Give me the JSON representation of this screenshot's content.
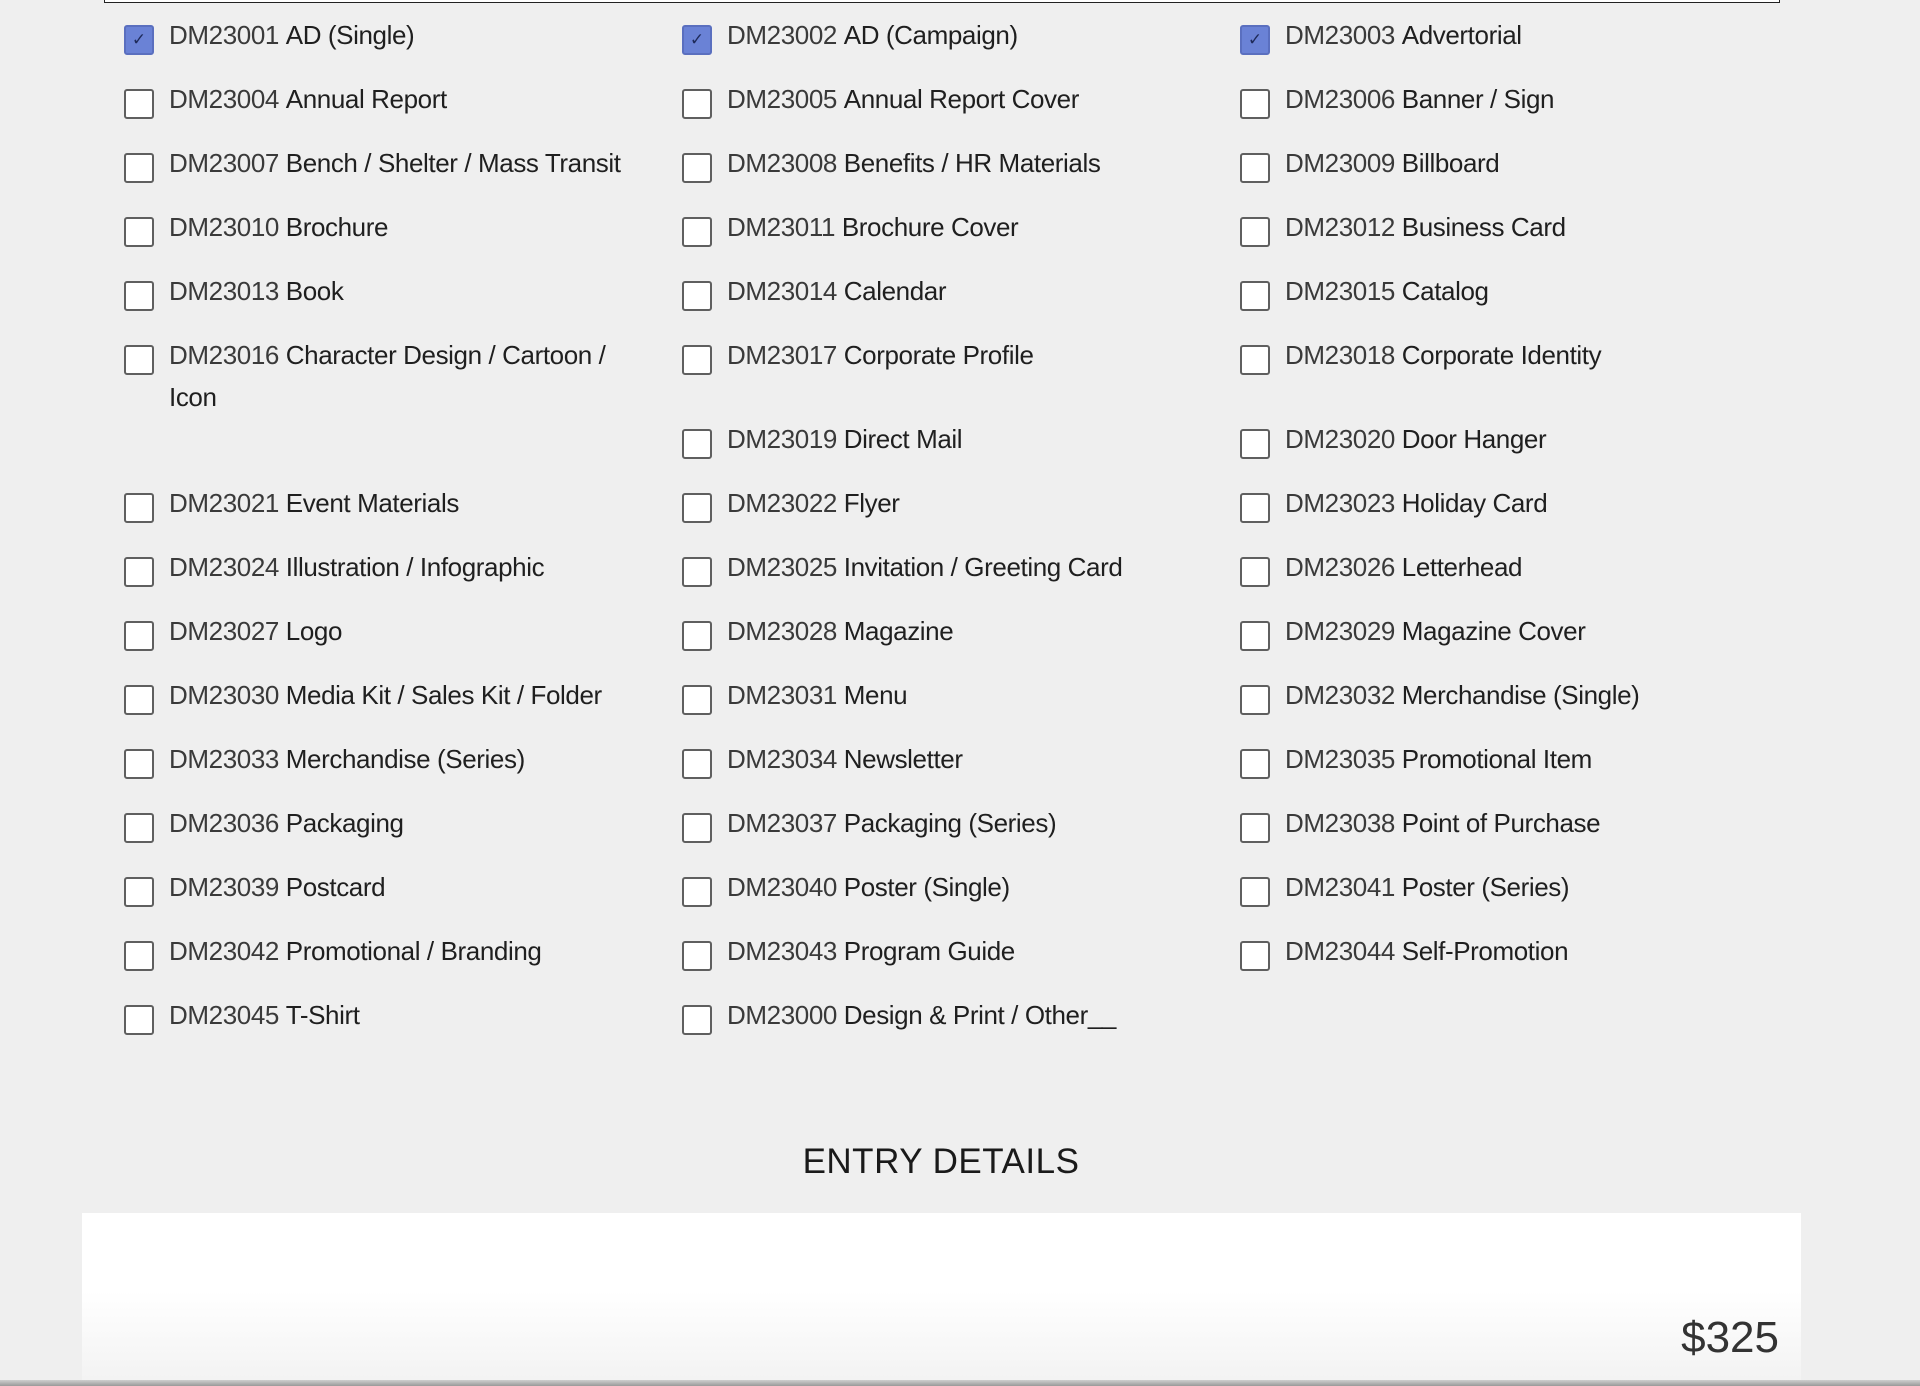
{
  "categories": [
    {
      "code": "DM23001",
      "name": "AD (Single)",
      "checked": true
    },
    {
      "code": "DM23002",
      "name": "AD (Campaign)",
      "checked": true
    },
    {
      "code": "DM23003",
      "name": "Advertorial",
      "checked": true
    },
    {
      "code": "DM23004",
      "name": "Annual Report",
      "checked": false
    },
    {
      "code": "DM23005",
      "name": "Annual Report Cover",
      "checked": false
    },
    {
      "code": "DM23006",
      "name": "Banner / Sign",
      "checked": false
    },
    {
      "code": "DM23007",
      "name": "Bench / Shelter / Mass Transit",
      "checked": false
    },
    {
      "code": "DM23008",
      "name": "Benefits / HR Materials",
      "checked": false
    },
    {
      "code": "DM23009",
      "name": "Billboard",
      "checked": false
    },
    {
      "code": "DM23010",
      "name": "Brochure",
      "checked": false
    },
    {
      "code": "DM23011",
      "name": "Brochure Cover",
      "checked": false
    },
    {
      "code": "DM23012",
      "name": "Business Card",
      "checked": false
    },
    {
      "code": "DM23013",
      "name": "Book",
      "checked": false
    },
    {
      "code": "DM23014",
      "name": "Calendar",
      "checked": false
    },
    {
      "code": "DM23015",
      "name": "Catalog",
      "checked": false
    },
    {
      "code": "DM23016",
      "name": "Character Design / Cartoon / Icon",
      "checked": false
    },
    {
      "code": "DM23017",
      "name": "Corporate Profile",
      "checked": false
    },
    {
      "code": "DM23018",
      "name": "Corporate Identity",
      "checked": false
    },
    {
      "code": "",
      "name": "",
      "checked": false,
      "placeholder": true
    },
    {
      "code": "DM23019",
      "name": "Direct Mail",
      "checked": false
    },
    {
      "code": "DM23020",
      "name": "Door Hanger",
      "checked": false
    },
    {
      "code": "DM23021",
      "name": "Event Materials",
      "checked": false
    },
    {
      "code": "DM23022",
      "name": "Flyer",
      "checked": false
    },
    {
      "code": "DM23023",
      "name": "Holiday Card",
      "checked": false
    },
    {
      "code": "DM23024",
      "name": "Illustration / Infographic",
      "checked": false
    },
    {
      "code": "DM23025",
      "name": "Invitation / Greeting Card",
      "checked": false
    },
    {
      "code": "DM23026",
      "name": "Letterhead",
      "checked": false
    },
    {
      "code": "DM23027",
      "name": "Logo",
      "checked": false
    },
    {
      "code": "DM23028",
      "name": "Magazine",
      "checked": false
    },
    {
      "code": "DM23029",
      "name": "Magazine Cover",
      "checked": false
    },
    {
      "code": "DM23030",
      "name": "Media Kit / Sales Kit / Folder",
      "checked": false
    },
    {
      "code": "DM23031",
      "name": "Menu",
      "checked": false
    },
    {
      "code": "DM23032",
      "name": "Merchandise (Single)",
      "checked": false
    },
    {
      "code": "DM23033",
      "name": "Merchandise (Series)",
      "checked": false
    },
    {
      "code": "DM23034",
      "name": "Newsletter",
      "checked": false
    },
    {
      "code": "DM23035",
      "name": "Promotional Item",
      "checked": false
    },
    {
      "code": "DM23036",
      "name": "Packaging",
      "checked": false
    },
    {
      "code": "DM23037",
      "name": "Packaging (Series)",
      "checked": false
    },
    {
      "code": "DM23038",
      "name": "Point of Purchase",
      "checked": false
    },
    {
      "code": "DM23039",
      "name": "Postcard",
      "checked": false
    },
    {
      "code": "DM23040",
      "name": "Poster (Single)",
      "checked": false
    },
    {
      "code": "DM23041",
      "name": "Poster (Series)",
      "checked": false
    },
    {
      "code": "DM23042",
      "name": "Promotional / Branding",
      "checked": false
    },
    {
      "code": "DM23043",
      "name": "Program Guide",
      "checked": false
    },
    {
      "code": "DM23044",
      "name": "Self-Promotion",
      "checked": false
    },
    {
      "code": "DM23045",
      "name": "T-Shirt",
      "checked": false
    },
    {
      "code": "DM23000",
      "name": "Design & Print / Other__",
      "checked": false
    }
  ],
  "entry_details": {
    "heading": "ENTRY DETAILS",
    "price": "$325"
  },
  "colors": {
    "checkbox_checked": "#6a82d6",
    "page_background": "#efefef"
  }
}
